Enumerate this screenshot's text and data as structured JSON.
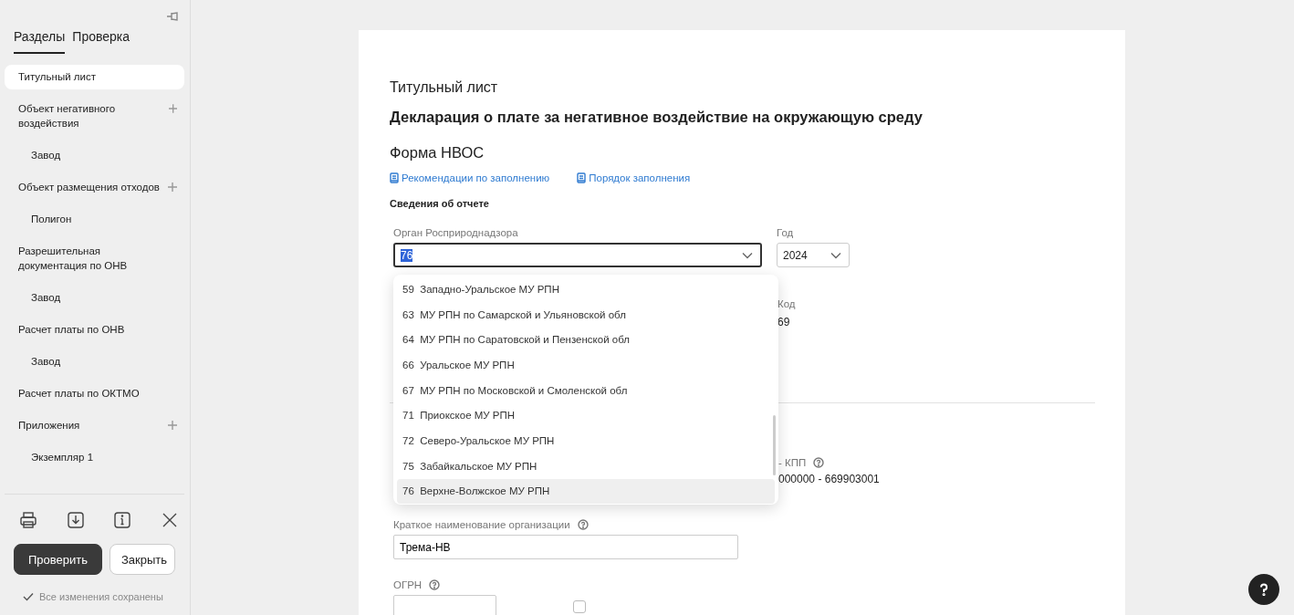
{
  "sidebar": {
    "tabs": [
      {
        "label": "Разделы",
        "selected": true
      },
      {
        "label": "Проверка",
        "selected": false
      }
    ],
    "items": [
      {
        "label": "Титульный лист",
        "selected": true,
        "addable": false
      },
      {
        "label": "Объект негативного воздействия",
        "selected": false,
        "addable": true,
        "children": [
          {
            "label": "Завод",
            "selected": false
          }
        ]
      },
      {
        "label": "Объект размещения отходов",
        "selected": false,
        "addable": true,
        "children": [
          {
            "label": "Полигон",
            "selected": false
          }
        ]
      },
      {
        "label": "Разрешительная документация по ОНВ",
        "selected": false,
        "addable": false,
        "children": [
          {
            "label": "Завод",
            "selected": false
          }
        ]
      },
      {
        "label": "Расчет платы по ОНВ",
        "selected": false,
        "addable": false,
        "children": [
          {
            "label": "Завод",
            "selected": false
          }
        ]
      },
      {
        "label": "Расчет платы по ОКТМО",
        "selected": false,
        "addable": false
      },
      {
        "label": "Приложения",
        "selected": false,
        "addable": true,
        "children": [
          {
            "label": "Экземпляр 1",
            "selected": false
          }
        ]
      }
    ],
    "buttons": [
      {
        "label": "Проверить",
        "kind": "primary"
      },
      {
        "label": "Закрыть",
        "kind": "secondary"
      }
    ],
    "status": "Все изменения сохранены"
  },
  "document": {
    "section": "Титульный лист",
    "title": "Декларация о плате за негативное воздействие на окружающую среду",
    "form_title": "Форма НВОС",
    "links": [
      "Рекомендации по заполнению",
      "Порядок заполнения"
    ],
    "subheading": "Сведения об отчете",
    "organ": {
      "label": "Орган Росприроднадзора",
      "value": "76",
      "value_highlighted": true,
      "expanded": true,
      "options": [
        {
          "label": "59  Западно-Уральское МУ РПН",
          "selected": false
        },
        {
          "label": "63  МУ РПН по Самарской и Ульяновской обл",
          "selected": false
        },
        {
          "label": "64  МУ РПН по Саратовской и Пензенской обл",
          "selected": false
        },
        {
          "label": "66  Уральское МУ РПН",
          "selected": false
        },
        {
          "label": "67  МУ РПН по Московской и Смоленской обл",
          "selected": false
        },
        {
          "label": "71  Приокское МУ РПН",
          "selected": false
        },
        {
          "label": "72  Северо-Уральское МУ РПН",
          "selected": false
        },
        {
          "label": "75  Забайкальское МУ РПН",
          "selected": false
        },
        {
          "label": "76  Верхне-Волжское МУ РПН",
          "selected": true
        }
      ]
    },
    "year": {
      "label": "Год",
      "value": "2024"
    },
    "code": {
      "label": "Код",
      "value": "69"
    },
    "inn_kpp": {
      "label": "- КПП",
      "value": "000000 - 669903001"
    },
    "short_name": {
      "label": "Краткое наименование организации",
      "value": "Трема-НВ"
    },
    "ogrn": {
      "label": "ОГРН"
    },
    "checkbox": {
      "checked": false
    }
  }
}
